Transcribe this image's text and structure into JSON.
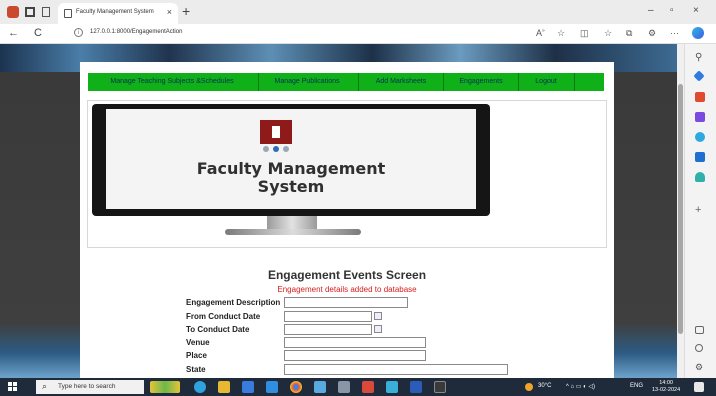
{
  "browser": {
    "tab_title": "Faculty Management System",
    "tab_close": "×",
    "new_tab": "+",
    "url": "127.0.0.1:8000/EngagementAction",
    "back": "←",
    "refresh": "C",
    "info": "i",
    "window_minimize": "–",
    "window_restore": "▫",
    "window_close": "×",
    "more": "···",
    "side_add": "+"
  },
  "menu": {
    "items": [
      "Manage Teaching Subjects &Schedules",
      "Manage Publications",
      "Add Marksheets",
      "Engagements",
      "Logout"
    ]
  },
  "banner": {
    "line1": "Faculty Management",
    "line2": "System"
  },
  "page": {
    "heading": "Engagement Events Screen",
    "status_message": "Engagement details added to database",
    "form": {
      "engagement_description_label": "Engagement Description",
      "from_date_label": "From Conduct Date",
      "to_date_label": "To Conduct Date",
      "venue_label": "Venue",
      "place_label": "Place",
      "state_label": "State"
    }
  },
  "taskbar": {
    "search_placeholder": "Type here to search",
    "temperature": "30°C",
    "language": "ENG",
    "time": "14:00",
    "date": "13-02-2024"
  },
  "colors": {
    "menu_bg": "#10b018",
    "menu_text": "#08305a",
    "status_red": "#d81d1d",
    "taskbar_bg": "#1f2b3a",
    "logo_red": "#8f1a1a"
  },
  "icons": {
    "search": "search-icon",
    "calendar": "calendar-icon",
    "favorite": "star-icon",
    "read_aloud": "read-aloud-icon",
    "split": "split-screen-icon",
    "collections": "collections-icon",
    "extensions": "extensions-icon",
    "copilot": "copilot-icon"
  }
}
